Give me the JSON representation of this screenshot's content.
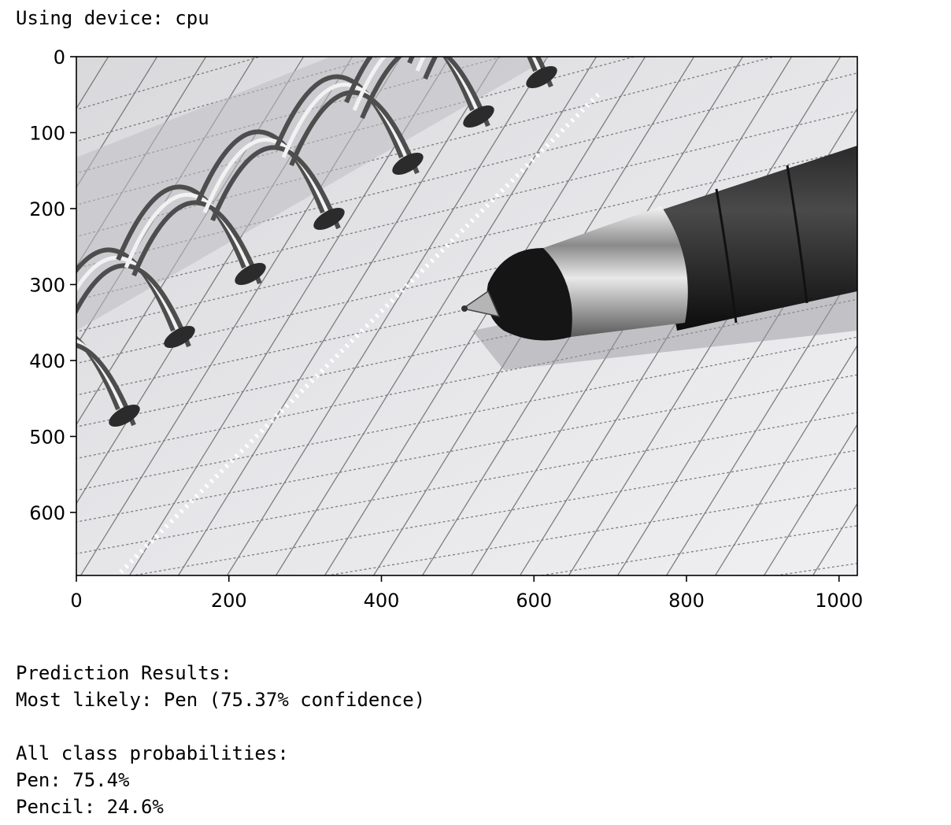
{
  "output": {
    "device_line": "Using device: cpu",
    "results_header": "Prediction Results:",
    "most_likely": "Most likely: Pen (75.37% confidence)",
    "all_probs_header": "All class probabilities:",
    "class_lines": [
      "Pen: 75.4%",
      "Pencil: 24.6%"
    ]
  },
  "image_plot": {
    "x_ticks": [
      "0",
      "200",
      "400",
      "600",
      "800",
      "1000"
    ],
    "x_values": [
      0,
      200,
      400,
      600,
      800,
      1000
    ],
    "y_ticks": [
      "0",
      "100",
      "200",
      "300",
      "400",
      "500",
      "600"
    ],
    "y_values": [
      0,
      100,
      200,
      300,
      400,
      500,
      600
    ],
    "x_range": [
      0,
      1024
    ],
    "y_range": [
      0,
      683
    ],
    "content": "spiral notebook with grid paper and black ballpoint pen"
  }
}
